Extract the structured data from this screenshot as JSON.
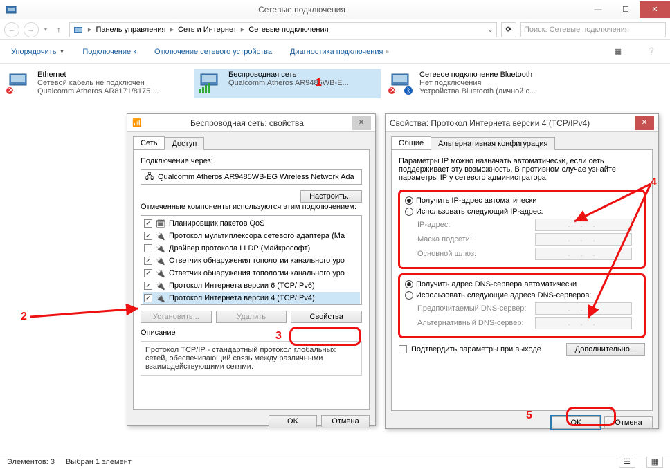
{
  "window": {
    "title": "Сетевые подключения",
    "breadcrumb": [
      "Панель управления",
      "Сеть и Интернет",
      "Сетевые подключения"
    ],
    "search_placeholder": "Поиск: Сетевые подключения"
  },
  "toolbar": {
    "organize": "Упорядочить",
    "connect": "Подключение к",
    "disconnect": "Отключение сетевого устройства",
    "diagnose": "Диагностика подключения"
  },
  "connections": [
    {
      "name": "Ethernet",
      "state": "Сетевой кабель не подключен",
      "device": "Qualcomm Atheros AR8171/8175 ..."
    },
    {
      "name": "Беспроводная сеть",
      "state": "",
      "device": "Qualcomm Atheros AR9485WB-E..."
    },
    {
      "name": "Сетевое подключение Bluetooth",
      "state": "Нет подключения",
      "device": "Устройства Bluetooth (личной с..."
    }
  ],
  "props_dialog": {
    "title": "Беспроводная сеть: свойства",
    "tabs": {
      "net": "Сеть",
      "access": "Доступ"
    },
    "connect_via_label": "Подключение через:",
    "adapter": "Qualcomm Atheros AR9485WB-EG Wireless Network Ada",
    "configure_btn": "Настроить...",
    "components_label": "Отмеченные компоненты используются этим подключением:",
    "components": [
      {
        "checked": true,
        "label": "Планировщик пакетов QoS"
      },
      {
        "checked": true,
        "label": "Протокол мультиплексора сетевого адаптера (Ма"
      },
      {
        "checked": false,
        "label": "Драйвер протокола LLDP (Майкрософт)"
      },
      {
        "checked": true,
        "label": "Ответчик обнаружения топологии канального уро"
      },
      {
        "checked": true,
        "label": "Ответчик обнаружения топологии канального уро"
      },
      {
        "checked": true,
        "label": "Протокол Интернета версии 6 (TCP/IPv6)"
      },
      {
        "checked": true,
        "label": "Протокол Интернета версии 4 (TCP/IPv4)"
      }
    ],
    "install_btn": "Установить...",
    "remove_btn": "Удалить",
    "properties_btn": "Свойства",
    "desc_heading": "Описание",
    "description": "Протокол TCP/IP - стандартный протокол глобальных сетей, обеспечивающий связь между различными взаимодействующими сетями.",
    "ok": "OK",
    "cancel": "Отмена"
  },
  "ipv4_dialog": {
    "title": "Свойства: Протокол Интернета версии 4 (TCP/IPv4)",
    "tabs": {
      "general": "Общие",
      "alt": "Альтернативная конфигурация"
    },
    "intro": "Параметры IP можно назначать автоматически, если сеть поддерживает эту возможность. В противном случае узнайте параметры IP у сетевого администратора.",
    "ip_auto": "Получить IP-адрес автоматически",
    "ip_manual": "Использовать следующий IP-адрес:",
    "ip_label": "IP-адрес:",
    "mask_label": "Маска подсети:",
    "gw_label": "Основной шлюз:",
    "dns_auto": "Получить адрес DNS-сервера автоматически",
    "dns_manual": "Использовать следующие адреса DNS-серверов:",
    "dns_pref": "Предпочитаемый DNS-сервер:",
    "dns_alt": "Альтернативный DNS-сервер:",
    "confirm_exit": "Подтвердить параметры при выходе",
    "advanced": "Дополнительно...",
    "ok": "ОК",
    "cancel": "Отмена"
  },
  "statusbar": {
    "count": "Элементов: 3",
    "selected": "Выбран 1 элемент"
  },
  "annotations": {
    "n1": "1",
    "n2": "2",
    "n3": "3",
    "n4": "4",
    "n5": "5"
  }
}
